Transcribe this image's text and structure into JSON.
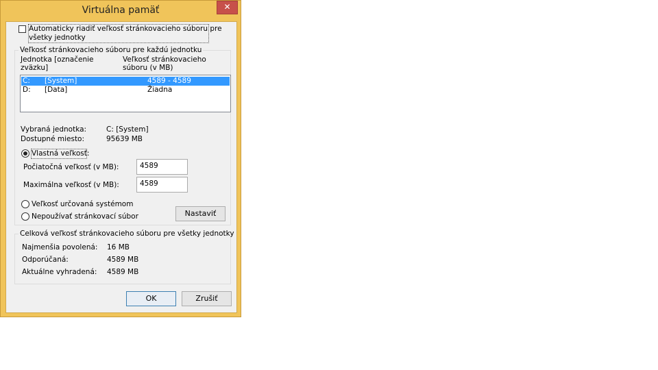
{
  "window": {
    "title": "Virtuálna pamäť",
    "close_glyph": "✕"
  },
  "auto_manage": {
    "checked": false,
    "label_line1": "Automaticky riadiť veľkosť stránkovacieho súboru pre",
    "label_line2": "všetky jednotky"
  },
  "per_drive": {
    "group_label": "Veľkosť stránkovacieho súboru pre každú jednotku",
    "col_drive_line1": "Jednotka [označenie",
    "col_drive_line2": "zväzku]",
    "col_size_line1": "Veľkosť stránkovacieho",
    "col_size_line2": "súboru (v MB)",
    "drives": [
      {
        "letter": "C:",
        "label": "[System]",
        "size": "4589 - 4589",
        "selected": true
      },
      {
        "letter": "D:",
        "label": "[Data]",
        "size": "Žiadna",
        "selected": false
      }
    ],
    "selected_drive_label": "Vybraná jednotka:",
    "selected_drive_value": "C:  [System]",
    "free_space_label": "Dostupné miesto:",
    "free_space_value": "95639 MB",
    "custom_size_label": "Vlastná veľkosť:",
    "custom_size_selected": true,
    "initial_size_label": "Počiatočná veľkosť (v MB):",
    "initial_size_value": "4589",
    "max_size_label": "Maximálna veľkosť (v MB):",
    "max_size_value": "4589",
    "system_managed_label": "Veľkosť určovaná systémom",
    "no_paging_label": "Nepoužívať stránkovací súbor",
    "set_button": "Nastaviť"
  },
  "total": {
    "group_label": "Celková veľkosť stránkovacieho súboru pre všetky jednotky",
    "min_label": "Najmenšia povolená:",
    "min_value": "16 MB",
    "recommended_label": "Odporúčaná:",
    "recommended_value": "4589 MB",
    "allocated_label": "Aktuálne vyhradená:",
    "allocated_value": "4589 MB"
  },
  "buttons": {
    "ok": "OK",
    "cancel": "Zrušiť"
  }
}
